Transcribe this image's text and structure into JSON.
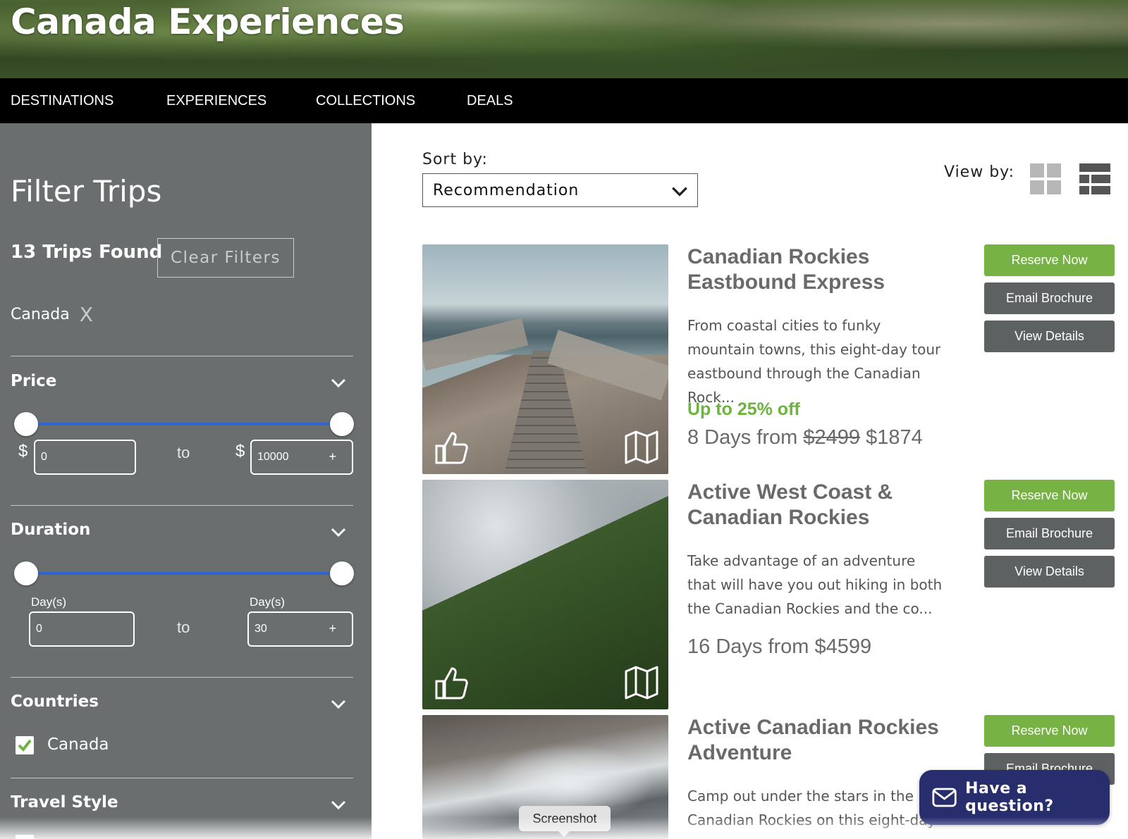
{
  "hero": {
    "title": "Canada Experiences"
  },
  "nav": {
    "items": [
      {
        "label": "DESTINATIONS"
      },
      {
        "label": "EXPERIENCES"
      },
      {
        "label": "COLLECTIONS"
      },
      {
        "label": "DEALS"
      }
    ]
  },
  "sidebar": {
    "title": "Filter Trips",
    "trips_found": "13 Trips Found",
    "clear_filters": "Clear Filters",
    "active_filter": "Canada",
    "active_filter_remove": "X",
    "price": {
      "title": "Price",
      "currency": "$",
      "min": "0",
      "max": "10000",
      "to": "to",
      "plus": "+"
    },
    "duration": {
      "title": "Duration",
      "unit": "Day(s)",
      "min": "0",
      "max": "30",
      "to": "to",
      "plus": "+"
    },
    "countries": {
      "title": "Countries",
      "options": [
        {
          "label": "Canada",
          "checked": true
        }
      ]
    },
    "travel_style": {
      "title": "Travel Style"
    }
  },
  "main": {
    "sort_label": "Sort by:",
    "sort_value": "Recommendation",
    "view_label": "View by:",
    "trips": [
      {
        "title_line1": "Canadian Rockies",
        "title_line2": "Eastbound Express",
        "desc": "From coastal cities to funky mountain towns, this eight-day tour eastbound through the Canadian Rock...",
        "deal": "Up to 25% off",
        "price_prefix": "8 Days from ",
        "price_old": "$2499",
        "price_new": " $1874",
        "reserve": "Reserve Now",
        "email": "Email Brochure",
        "details": "View Details"
      },
      {
        "title_line1": "Active West Coast &",
        "title_line2": "Canadian Rockies",
        "desc": "Take advantage of an adventure that will have you out hiking in both the Canadian Rockies and the co...",
        "price": "16 Days from $4599",
        "reserve": "Reserve Now",
        "email": "Email Brochure",
        "details": "View Details"
      },
      {
        "title_line1": "Active Canadian Rockies",
        "title_line2": "Adventure",
        "desc": "Camp out under the stars in the Canadian Rockies on this eight-day",
        "reserve": "Reserve Now",
        "email": "Email Brochure"
      }
    ]
  },
  "chat": {
    "label": "Have a question?"
  },
  "tooltip": {
    "label": "Screenshot"
  },
  "colors": {
    "accent_green": "#77b244",
    "deal_green": "#6db33f",
    "sidebar_bg": "#6a6e6e",
    "slider_blue": "#2e67d3",
    "chat_bg": "#282d6e"
  }
}
